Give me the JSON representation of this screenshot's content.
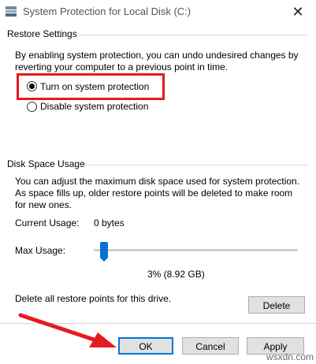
{
  "window": {
    "title": "System Protection for Local Disk (C:)",
    "close_glyph": "✕"
  },
  "restore_settings": {
    "heading": "Restore Settings",
    "description": "By enabling system protection, you can undo undesired changes by reverting your computer to a previous point in time.",
    "options": [
      {
        "label": "Turn on system protection",
        "selected": true
      },
      {
        "label": "Disable system protection",
        "selected": false
      }
    ]
  },
  "disk_space": {
    "heading": "Disk Space Usage",
    "description": "You can adjust the maximum disk space used for system protection. As space fills up, older restore points will be deleted to make room for new ones.",
    "current_usage_label": "Current Usage:",
    "current_usage_value": "0 bytes",
    "max_usage_label": "Max Usage:",
    "max_usage_percent": 3,
    "max_usage_readout": "3% (8.92 GB)",
    "delete_text": "Delete all restore points for this drive.",
    "delete_button": "Delete"
  },
  "footer": {
    "ok": "OK",
    "cancel": "Cancel",
    "apply": "Apply"
  },
  "watermark": "wsxdn.com",
  "colors": {
    "highlight": "#e31b23",
    "slider_thumb": "#0a6fd3",
    "default_button_border": "#0078d7"
  }
}
